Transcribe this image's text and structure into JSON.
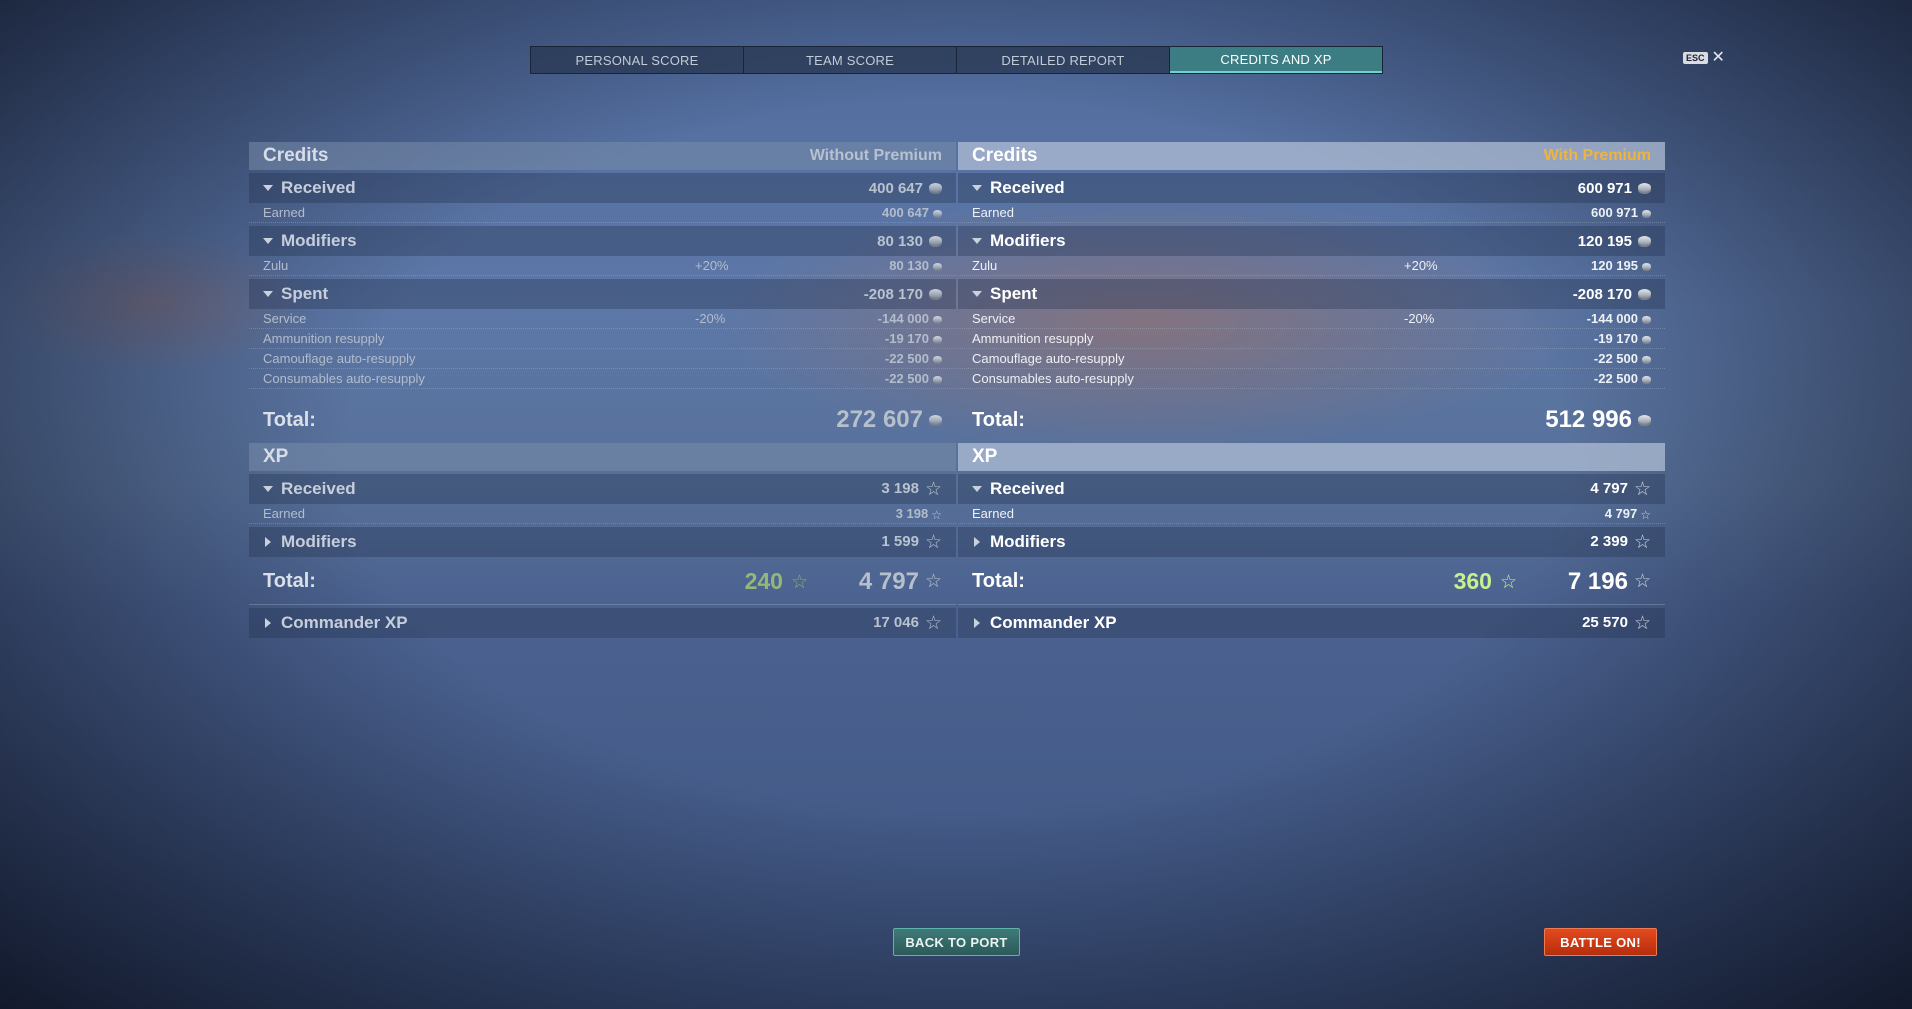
{
  "tabs": [
    {
      "label": "PERSONAL SCORE"
    },
    {
      "label": "TEAM SCORE"
    },
    {
      "label": "DETAILED REPORT"
    },
    {
      "label": "CREDITS AND XP"
    }
  ],
  "esc_label": "ESC",
  "close_glyph": "✕",
  "without": {
    "credits_title": "Credits",
    "column_label": "Without Premium",
    "received": {
      "label": "Received",
      "value": "400 647"
    },
    "earned": {
      "label": "Earned",
      "value": "400 647"
    },
    "modifiers": {
      "label": "Modifiers",
      "value": "80 130"
    },
    "zulu": {
      "label": "Zulu",
      "pct": "+20%",
      "value": "80 130"
    },
    "spent": {
      "label": "Spent",
      "value": "-208 170"
    },
    "service": {
      "label": "Service",
      "pct": "-20%",
      "value": "-144 000"
    },
    "ammo": {
      "label": "Ammunition resupply",
      "value": "-19 170"
    },
    "camo": {
      "label": "Camouflage auto-resupply",
      "value": "-22 500"
    },
    "consumables": {
      "label": "Consumables auto-resupply",
      "value": "-22 500"
    },
    "credits_total": {
      "label": "Total:",
      "value": "272 607"
    },
    "xp_title": "XP",
    "xp_received": {
      "label": "Received",
      "value": "3 198"
    },
    "xp_earned": {
      "label": "Earned",
      "value": "3 198"
    },
    "xp_modifiers": {
      "label": "Modifiers",
      "value": "1 599"
    },
    "xp_total": {
      "label": "Total:",
      "bonus": "240",
      "value": "4 797"
    },
    "commander_xp": {
      "label": "Commander XP",
      "value": "17 046"
    }
  },
  "with": {
    "credits_title": "Credits",
    "column_label": "With Premium",
    "received": {
      "label": "Received",
      "value": "600 971"
    },
    "earned": {
      "label": "Earned",
      "value": "600 971"
    },
    "modifiers": {
      "label": "Modifiers",
      "value": "120 195"
    },
    "zulu": {
      "label": "Zulu",
      "pct": "+20%",
      "value": "120 195"
    },
    "spent": {
      "label": "Spent",
      "value": "-208 170"
    },
    "service": {
      "label": "Service",
      "pct": "-20%",
      "value": "-144 000"
    },
    "ammo": {
      "label": "Ammunition resupply",
      "value": "-19 170"
    },
    "camo": {
      "label": "Camouflage auto-resupply",
      "value": "-22 500"
    },
    "consumables": {
      "label": "Consumables auto-resupply",
      "value": "-22 500"
    },
    "credits_total": {
      "label": "Total:",
      "value": "512 996"
    },
    "xp_title": "XP",
    "xp_received": {
      "label": "Received",
      "value": "4 797"
    },
    "xp_earned": {
      "label": "Earned",
      "value": "4 797"
    },
    "xp_modifiers": {
      "label": "Modifiers",
      "value": "2 399"
    },
    "xp_total": {
      "label": "Total:",
      "bonus": "360",
      "value": "7 196"
    },
    "commander_xp": {
      "label": "Commander XP",
      "value": "25 570"
    }
  },
  "buttons": {
    "back_to_port": "BACK TO PORT",
    "battle_on": "BATTLE ON!"
  },
  "icons": {
    "credit": "credit-coin-icon",
    "xp": "xp-star-icon"
  },
  "colors": {
    "active_tab": "#3c7d84",
    "premium_label": "#f2b33a",
    "xp_bonus": "#c9f08e",
    "battle_button": "#d23c16",
    "port_button": "#356b6a"
  }
}
